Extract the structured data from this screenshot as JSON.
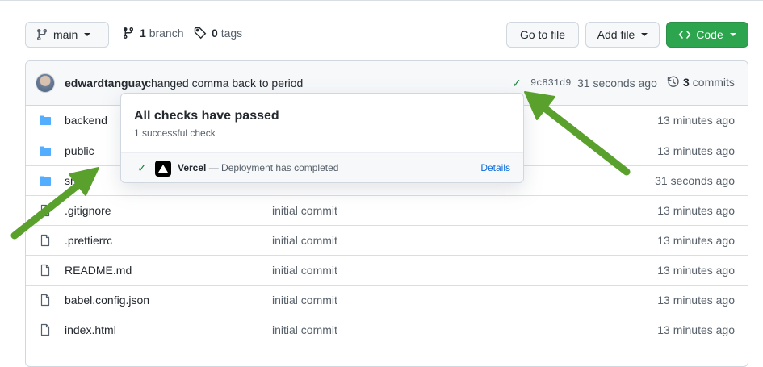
{
  "toolbar": {
    "branch_button": "main",
    "branch_count": "1",
    "branch_label": "branch",
    "tag_count": "0",
    "tag_label": "tags",
    "goto_file": "Go to file",
    "add_file": "Add file",
    "code": "Code"
  },
  "commit": {
    "author": "edwardtanguay",
    "message": "changed comma back to period",
    "sha": "9c831d9",
    "time": "31 seconds ago",
    "commit_count": "3",
    "commit_label": "commits"
  },
  "files": [
    {
      "name": "backend",
      "type": "folder",
      "message": "",
      "age": "13 minutes ago"
    },
    {
      "name": "public",
      "type": "folder",
      "message": "",
      "age": "13 minutes ago"
    },
    {
      "name": "src",
      "type": "folder",
      "message": "",
      "age": "31 seconds ago"
    },
    {
      "name": ".gitignore",
      "type": "file",
      "message": "initial commit",
      "age": "13 minutes ago"
    },
    {
      "name": ".prettierrc",
      "type": "file",
      "message": "initial commit",
      "age": "13 minutes ago"
    },
    {
      "name": "README.md",
      "type": "file",
      "message": "initial commit",
      "age": "13 minutes ago"
    },
    {
      "name": "babel.config.json",
      "type": "file",
      "message": "initial commit",
      "age": "13 minutes ago"
    },
    {
      "name": "index.html",
      "type": "file",
      "message": "initial commit",
      "age": "13 minutes ago"
    }
  ],
  "popover": {
    "title": "All checks have passed",
    "subtitle": "1 successful check",
    "check_name": "Vercel",
    "check_desc": " — Deployment has completed",
    "details": "Details"
  },
  "colors": {
    "green_button": "#2da44e",
    "success": "#1a7f37",
    "link": "#0969da",
    "folder": "#54aeff",
    "annotation_arrow": "#5aa02c"
  }
}
